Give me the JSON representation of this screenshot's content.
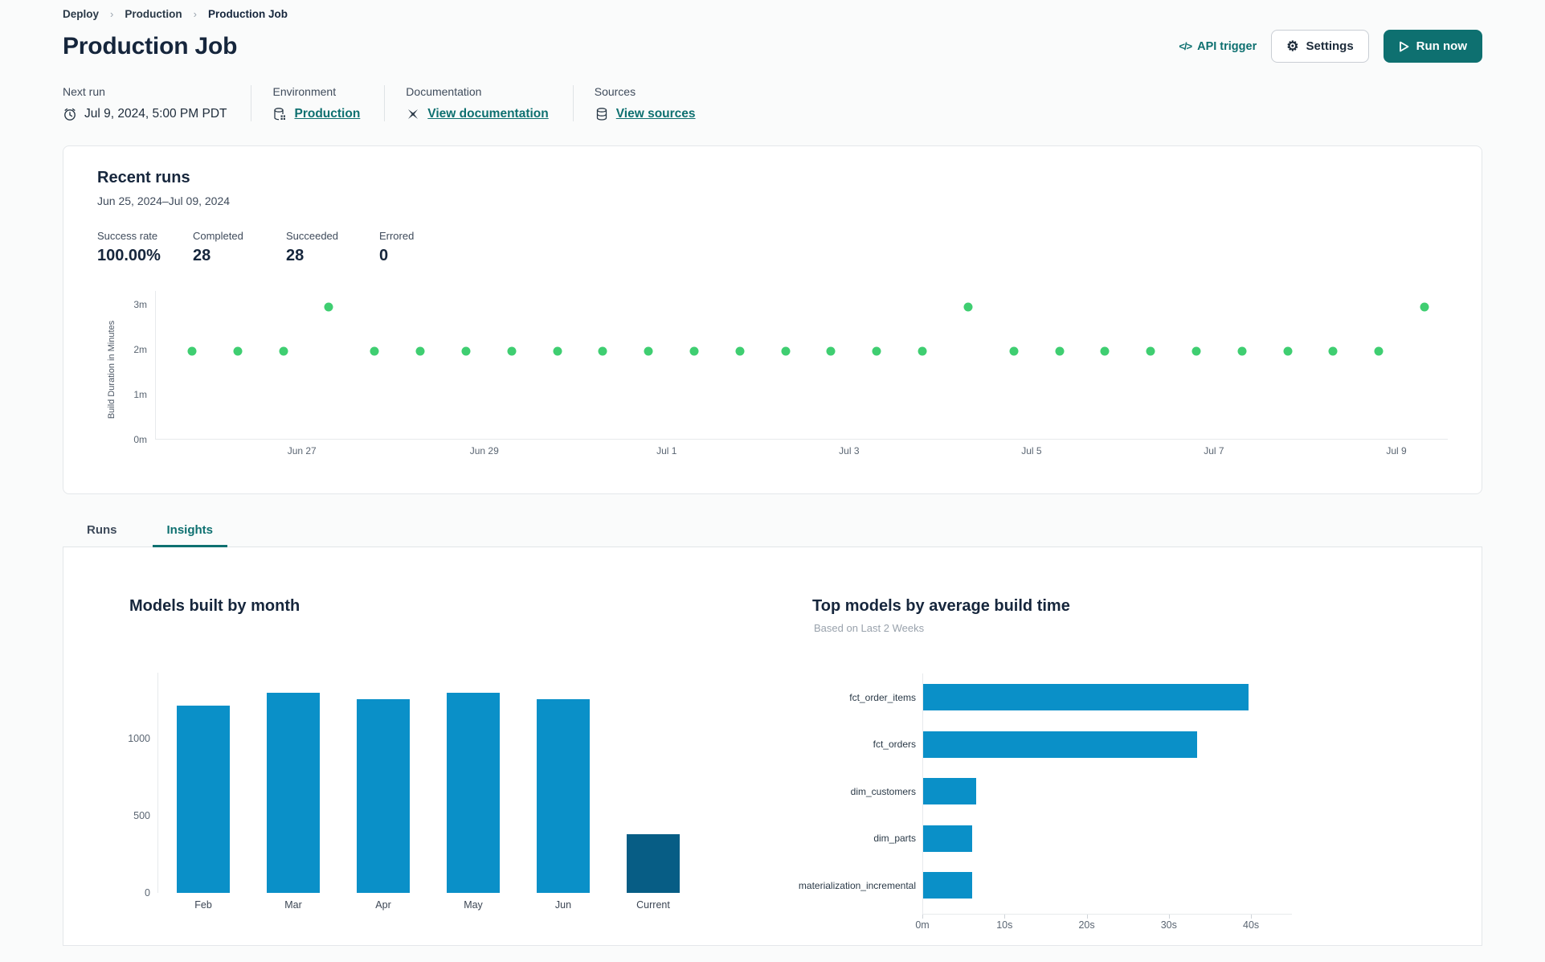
{
  "breadcrumb": {
    "items": [
      "Deploy",
      "Production",
      "Production Job"
    ]
  },
  "header": {
    "title": "Production Job",
    "api_trigger_label": "API trigger",
    "settings_label": "Settings",
    "run_now_label": "Run now"
  },
  "meta": {
    "next_run": {
      "label": "Next run",
      "value": "Jul 9, 2024, 5:00 PM PDT"
    },
    "environment": {
      "label": "Environment",
      "value": "Production"
    },
    "documentation": {
      "label": "Documentation",
      "value": "View documentation"
    },
    "sources": {
      "label": "Sources",
      "value": "View sources"
    }
  },
  "recent_runs": {
    "title": "Recent runs",
    "date_range": "Jun 25, 2024–Jul 09, 2024",
    "stats": [
      {
        "label": "Success rate",
        "value": "100.00%"
      },
      {
        "label": "Completed",
        "value": "28"
      },
      {
        "label": "Succeeded",
        "value": "28"
      },
      {
        "label": "Errored",
        "value": "0"
      }
    ]
  },
  "tabs": [
    {
      "label": "Runs",
      "active": false
    },
    {
      "label": "Insights",
      "active": true
    }
  ],
  "colors": {
    "accent": "#0e7070",
    "dot_green": "#3fce71",
    "bar_blue": "#0a90c8",
    "bar_dark": "#075d85",
    "axis_line": "#e7eaec"
  },
  "chart_data": [
    {
      "type": "scatter",
      "title": "Recent runs build duration",
      "ylabel": "Build Duration in Minutes",
      "yticks": [
        "0m",
        "1m",
        "2m",
        "3m"
      ],
      "ytick_values": [
        0,
        1,
        2,
        3
      ],
      "ylim": [
        0,
        3.3
      ],
      "xticks": [
        "Jun 27",
        "Jun 29",
        "Jul 1",
        "Jul 3",
        "Jul 5",
        "Jul 7",
        "Jul 9"
      ],
      "points_minutes": [
        1.97,
        1.97,
        1.97,
        2.95,
        1.97,
        1.97,
        1.97,
        1.97,
        1.97,
        1.97,
        1.97,
        1.97,
        1.97,
        1.97,
        1.97,
        1.97,
        1.97,
        2.95,
        1.97,
        1.97,
        1.97,
        1.97,
        1.97,
        1.97,
        1.97,
        1.97,
        1.97,
        2.95
      ],
      "point_color": "#3fce71",
      "legend": "none",
      "grid": false
    },
    {
      "type": "bar",
      "title": "Models built by month",
      "categories": [
        "Feb",
        "Mar",
        "Apr",
        "May",
        "Jun",
        "Current"
      ],
      "values": [
        1215,
        1300,
        1260,
        1297,
        1260,
        380
      ],
      "bar_colors": [
        "#0a90c8",
        "#0a90c8",
        "#0a90c8",
        "#0a90c8",
        "#0a90c8",
        "#075d85"
      ],
      "yticks": [
        0,
        500,
        1000
      ],
      "ylim": [
        0,
        1430
      ],
      "xlabel": "",
      "ylabel": "",
      "grid": false,
      "legend": "none"
    },
    {
      "type": "bar-horizontal",
      "title": "Top models by average build time",
      "subtitle": "Based on Last 2 Weeks",
      "categories": [
        "fct_order_items",
        "fct_orders",
        "dim_customers",
        "dim_parts",
        "materialization_incremental"
      ],
      "values_seconds": [
        39.6,
        33.3,
        6.5,
        6.0,
        6.0
      ],
      "xticks": [
        "0m",
        "10s",
        "20s",
        "30s",
        "40s"
      ],
      "xtick_values": [
        0,
        10,
        20,
        30,
        40
      ],
      "xlim": [
        0,
        44
      ],
      "bar_color": "#0a90c8",
      "grid": false,
      "legend": "none"
    }
  ]
}
